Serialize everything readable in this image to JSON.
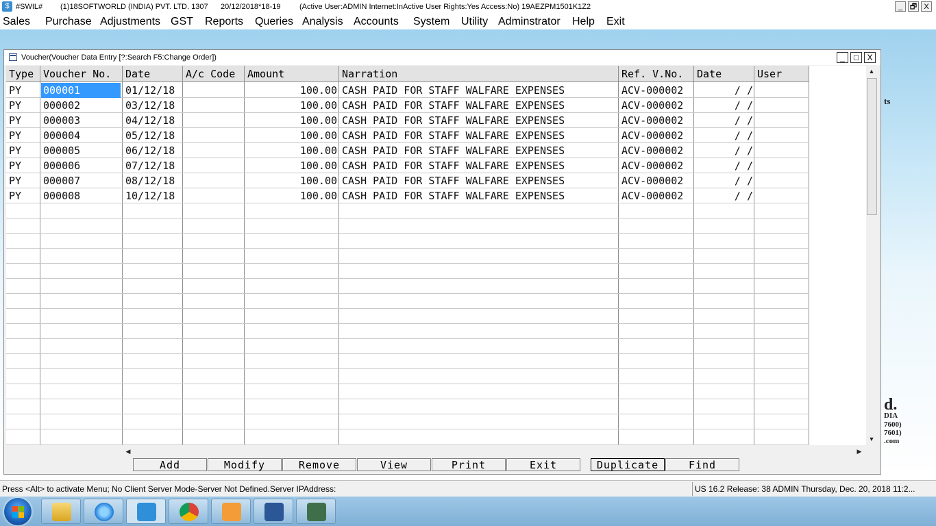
{
  "app": {
    "title_segments": [
      "#SWIL#",
      "(1)18SOFTWORLD (INDIA) PVT. LTD. 1307",
      "20/12/2018*18-19",
      "(Active User:ADMIN Internet:InActive User Rights:Yes Access:No) 19AEZPM1501K1Z2"
    ],
    "window_controls": {
      "minimize": "_",
      "restore": "🗗",
      "close": "X"
    }
  },
  "menu": [
    "Sales",
    "Purchase",
    "Adjustments",
    "GST",
    "Reports",
    "Queries",
    "Analysis",
    "Accounts",
    "System",
    "Utility",
    "Adminstrator",
    "Help",
    "Exit"
  ],
  "child_window": {
    "title": "Voucher(Voucher Data Entry [?:Search F5:Change Order])",
    "controls": {
      "minimize": "_",
      "restore": "□",
      "close": "X"
    }
  },
  "table": {
    "columns": [
      "Type",
      "Voucher No.",
      "Date",
      "A/c Code",
      "Amount",
      "Narration",
      "Ref. V.No.",
      "Date",
      "User"
    ],
    "rows": [
      [
        "PY",
        "000001",
        "01/12/18",
        "",
        "100.00",
        "CASH PAID FOR STAFF WALFARE EXPENSES",
        "ACV-000002",
        "/   /",
        ""
      ],
      [
        "PY",
        "000002",
        "03/12/18",
        "",
        "100.00",
        "CASH PAID FOR STAFF WALFARE EXPENSES",
        "ACV-000002",
        "/   /",
        ""
      ],
      [
        "PY",
        "000003",
        "04/12/18",
        "",
        "100.00",
        "CASH PAID FOR STAFF WALFARE EXPENSES",
        "ACV-000002",
        "/   /",
        ""
      ],
      [
        "PY",
        "000004",
        "05/12/18",
        "",
        "100.00",
        "CASH PAID FOR STAFF WALFARE EXPENSES",
        "ACV-000002",
        "/   /",
        ""
      ],
      [
        "PY",
        "000005",
        "06/12/18",
        "",
        "100.00",
        "CASH PAID FOR STAFF WALFARE EXPENSES",
        "ACV-000002",
        "/   /",
        ""
      ],
      [
        "PY",
        "000006",
        "07/12/18",
        "",
        "100.00",
        "CASH PAID FOR STAFF WALFARE EXPENSES",
        "ACV-000002",
        "/   /",
        ""
      ],
      [
        "PY",
        "000007",
        "08/12/18",
        "",
        "100.00",
        "CASH PAID FOR STAFF WALFARE EXPENSES",
        "ACV-000002",
        "/   /",
        ""
      ],
      [
        "PY",
        "000008",
        "10/12/18",
        "",
        "100.00",
        "CASH PAID FOR STAFF WALFARE EXPENSES",
        "ACV-000002",
        "/   /",
        ""
      ]
    ],
    "selected_value": "000001"
  },
  "buttons": [
    "Add",
    "Modify",
    "Remove",
    "View",
    "Print",
    "Exit",
    "Duplicate",
    "Find"
  ],
  "status": {
    "left": "Press <Alt> to activate Menu; No Client Server Mode-Server Not Defined.Server IPAddress:",
    "right": "US 16.2 Release: 38 ADMIN  Thursday, Dec. 20, 2018  11:2..."
  },
  "desktop_fragments": [
    "d.",
    "DIA",
    "7600)",
    "7601)",
    ".com",
    "ts"
  ],
  "taskbar": {
    "items": [
      "start-orb",
      "file-explorer-icon",
      "internet-explorer-icon",
      "swil-app-icon",
      "chrome-icon",
      "media-player-icon",
      "word-icon",
      "task-manager-icon"
    ]
  },
  "colors": {
    "selection": "#3399ff",
    "taskbar": "#8cbbe0"
  }
}
